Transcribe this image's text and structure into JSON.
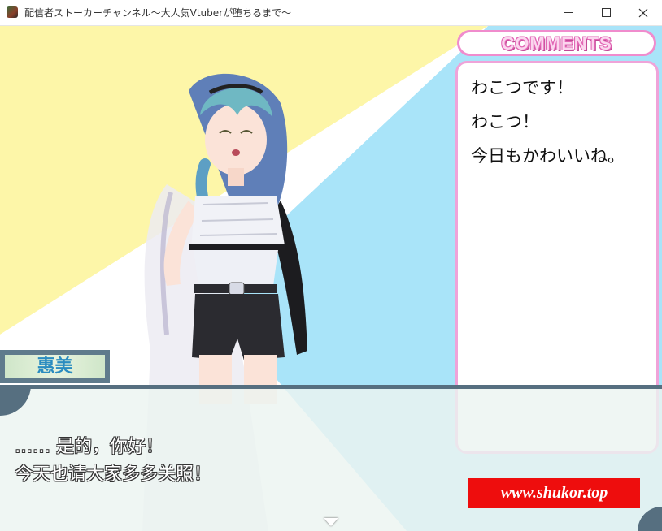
{
  "window": {
    "title": "配信者ストーカーチャンネル～大人気Vtuberが堕ちるまで～",
    "app_icon": "game-app-icon",
    "controls": [
      "minimize-icon",
      "maximize-icon",
      "close-icon"
    ]
  },
  "scene": {
    "background_colors": {
      "yellow": "#fdf6a8",
      "blue": "#a9e4f9",
      "white": "#ffffff"
    },
    "character": "vtuber-girl-teal-braid-sprite"
  },
  "comments": {
    "header": "COMMENTS",
    "items": [
      "わこつです！",
      "わこつ！",
      "今日もかわいいね。"
    ]
  },
  "dialogue": {
    "speaker": "惠美",
    "lines": [
      "…… 是的，你好！",
      "今天也请大家多多关照！"
    ]
  },
  "watermark": {
    "text": "www.shukor.top"
  },
  "colors": {
    "accent_pink": "#f08ccd",
    "frame_slate": "#566f80",
    "watermark_red": "#ee0d0d",
    "name_blue": "#2a8cc0"
  }
}
